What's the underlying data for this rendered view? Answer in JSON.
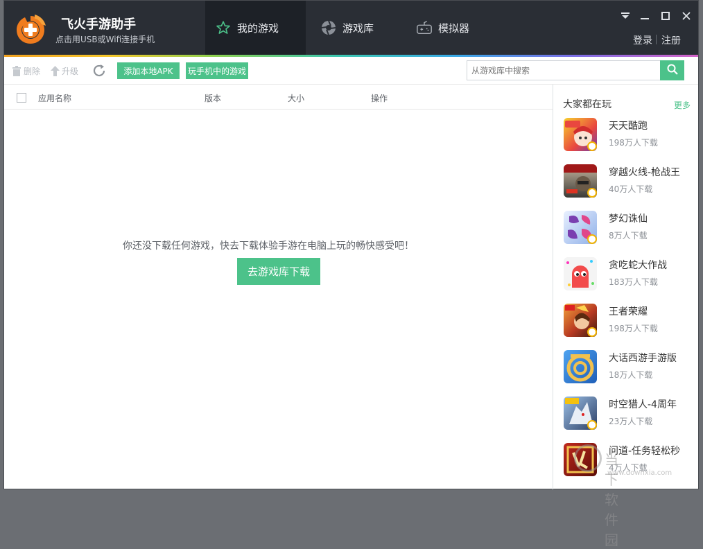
{
  "app": {
    "name": "飞火手游助手",
    "subtitle": "点击用USB或Wifi连接手机",
    "brand_color": "#f07c1e",
    "accent_color": "#4cc28a"
  },
  "nav": {
    "tabs": [
      {
        "label": "我的游戏",
        "icon": "star-icon",
        "active": true
      },
      {
        "label": "游戏库",
        "icon": "aperture-icon",
        "active": false
      },
      {
        "label": "模拟器",
        "icon": "gamepad-icon",
        "active": false
      }
    ]
  },
  "window_controls": {
    "menu": "▼",
    "minimize": "—",
    "maximize": "□",
    "close": "✕"
  },
  "auth": {
    "login": "登录",
    "register": "注册"
  },
  "toolbar": {
    "delete_label": "删除",
    "upgrade_label": "升级",
    "add_apk_label": "添加本地APK",
    "phone_games_label": "玩手机中的游戏",
    "search_placeholder": "从游戏库中搜索"
  },
  "table": {
    "columns": [
      "应用名称",
      "版本",
      "大小",
      "操作"
    ]
  },
  "empty_state": {
    "message": "你还没下载任何游戏，快去下载体验手游在电脑上玩的畅快感受吧！",
    "button": "去游戏库下载"
  },
  "sidebar": {
    "title": "大家都在玩",
    "more": "更多",
    "games": [
      {
        "name": "天天酷跑",
        "downloads": "198万人下载",
        "color": "#e9473f"
      },
      {
        "name": "穿越火线-枪战王",
        "downloads": "40万人下载",
        "color": "#3b3a36"
      },
      {
        "name": "梦幻诛仙",
        "downloads": "8万人下载",
        "color": "#8fb0e8"
      },
      {
        "name": "贪吃蛇大作战",
        "downloads": "183万人下载",
        "color": "#f2f2f2"
      },
      {
        "name": "王者荣耀",
        "downloads": "198万人下载",
        "color": "#b83a22"
      },
      {
        "name": "大话西游手游版",
        "downloads": "18万人下载",
        "color": "#2b7bd6"
      },
      {
        "name": "时空猎人-4周年",
        "downloads": "23万人下载",
        "color": "#5a7fa8"
      },
      {
        "name": "问道-任务轻松秒",
        "downloads": "4万人下载",
        "color": "#8a1a12"
      }
    ]
  },
  "watermark": {
    "text": "当下软件园",
    "url": "www.downxia.com"
  }
}
